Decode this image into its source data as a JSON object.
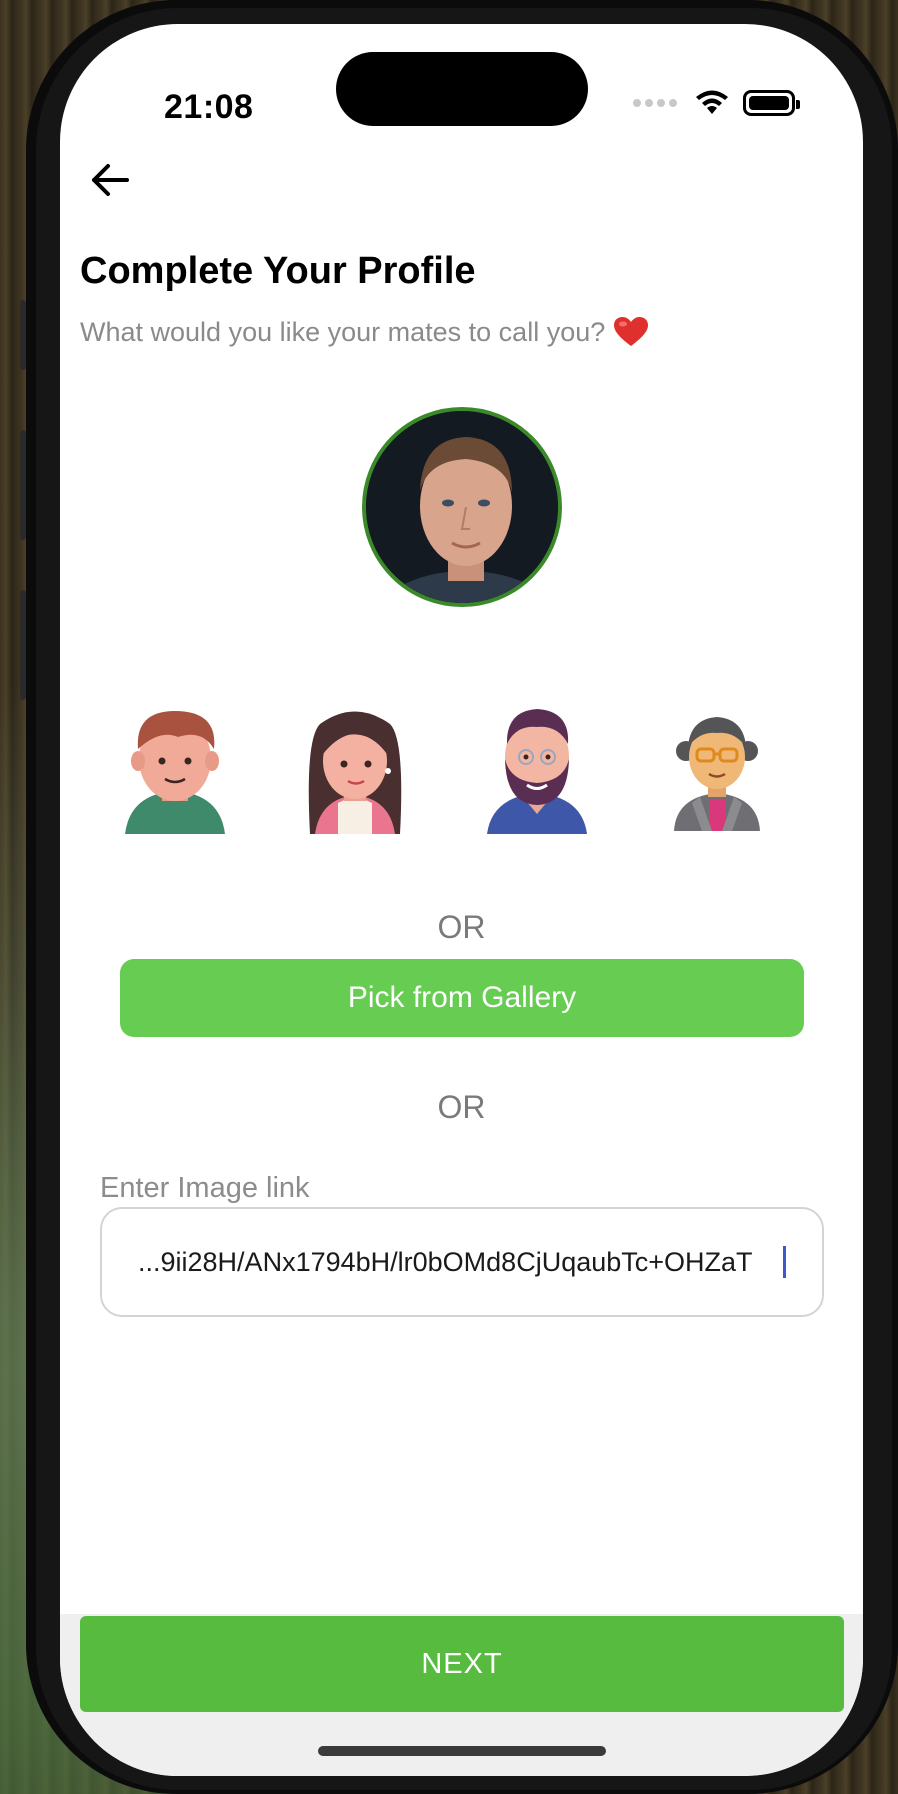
{
  "status_bar": {
    "time": "21:08"
  },
  "header": {
    "title": "Complete Your Profile",
    "subtitle": "What would you like your mates to call you?"
  },
  "avatars": [
    {
      "name": "boy-avatar"
    },
    {
      "name": "girl-avatar"
    },
    {
      "name": "bearded-man-avatar"
    },
    {
      "name": "woman-with-glasses-avatar"
    }
  ],
  "divider_1": "OR",
  "gallery_button": "Pick from Gallery",
  "divider_2": "OR",
  "image_link": {
    "label": "Enter Image link",
    "value": "9ii28H/ANx1794bH/lr0bOMd8CjUqaubTc+OHZaT..."
  },
  "next_button": "NEXT",
  "colors": {
    "accent_green": "#66cc52",
    "next_green": "#56bb3e",
    "photo_ring": "#3b8a2a",
    "caret": "#3a59d1"
  }
}
